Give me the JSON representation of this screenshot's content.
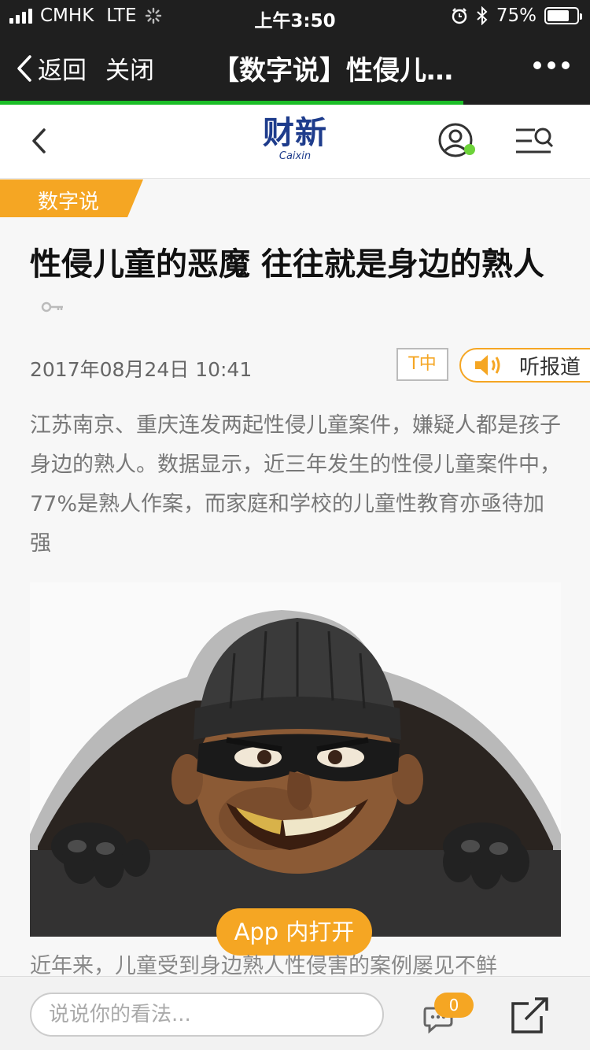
{
  "status": {
    "carrier": "CMHK",
    "network": "LTE",
    "time": "上午3:50",
    "battery_text": "75%",
    "battery_level": 0.75
  },
  "wechat": {
    "back_label": "返回",
    "close_label": "关闭",
    "title": "【数字说】性侵儿…",
    "load_progress": 0.785
  },
  "brand": {
    "logo_cn": "财新",
    "logo_en": "Caixin",
    "accent": "#f5a623",
    "logo_color": "#1e3c8c"
  },
  "article": {
    "category": "数字说",
    "title": "性侵儿童的恶魔 往往就是身边的熟人",
    "date": "2017年08月24日 10:41",
    "font_size_label": "T中",
    "listen_label": "听报道",
    "summary": "江苏南京、重庆连发两起性侵儿童案件，嫌疑人都是孩子身边的熟人。数据显示，近三年发生的性侵儿童案件中，77%是熟人作案，而家庭和学校的儿童性教育亦亟待加强",
    "open_in_app": "App 内打开",
    "body_start": "近年来，儿童受到身边熟人性侵害的案例屡见不鲜"
  },
  "bottombar": {
    "comment_placeholder": "说说你的看法...",
    "comment_count": "0"
  },
  "icons": [
    "signal-icon",
    "loading-spinner-icon",
    "alarm-icon",
    "bluetooth-icon",
    "battery-icon",
    "back-chevron-icon",
    "more-icon",
    "user-icon",
    "search-menu-icon",
    "key-icon",
    "speaker-icon",
    "chat-icon",
    "share-icon"
  ]
}
